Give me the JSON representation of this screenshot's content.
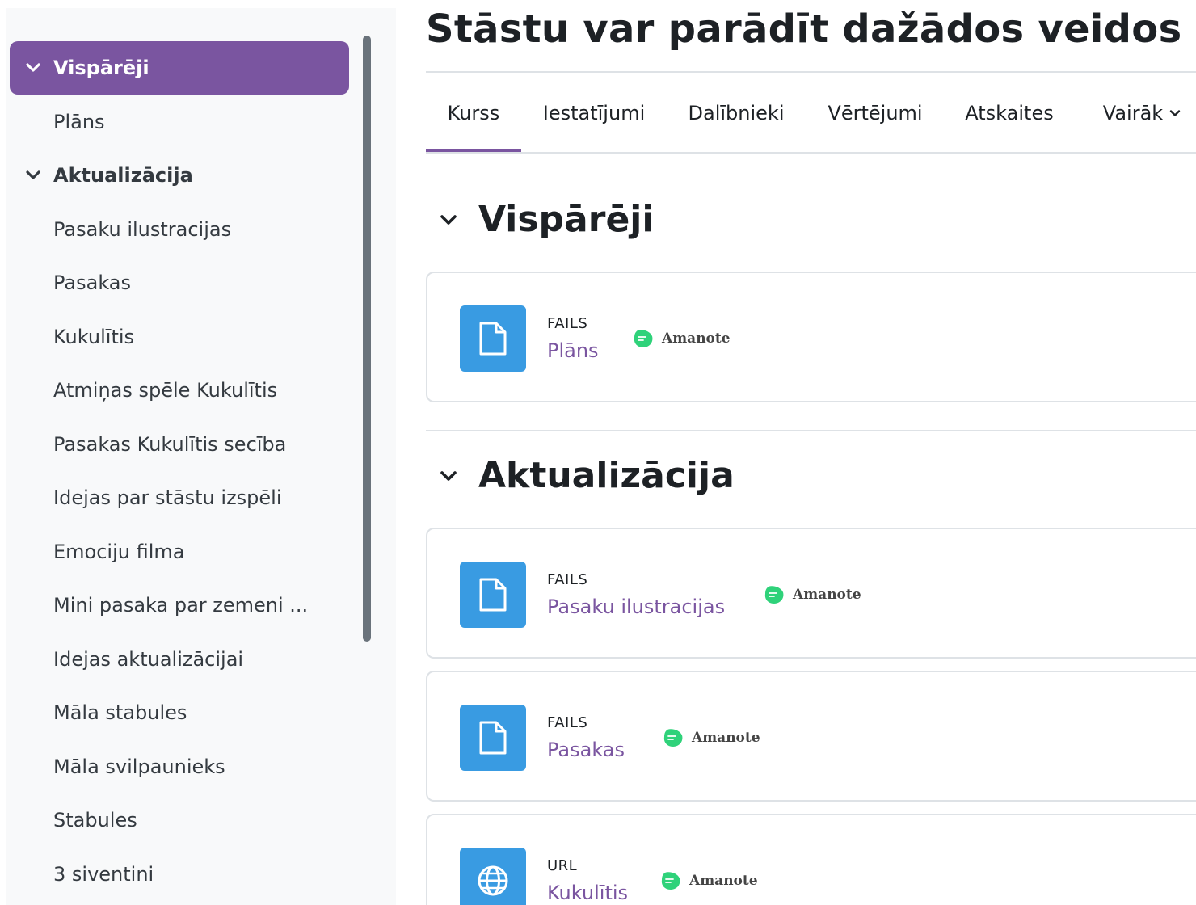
{
  "page_title": "Stāstu var parādīt dažādos veidos",
  "sidebar": {
    "items": [
      {
        "label": "Vispārēji",
        "kind": "section",
        "active": true
      },
      {
        "label": "Plāns",
        "kind": "item"
      },
      {
        "label": "Aktualizācija",
        "kind": "section"
      },
      {
        "label": "Pasaku ilustracijas",
        "kind": "item"
      },
      {
        "label": "Pasakas",
        "kind": "item"
      },
      {
        "label": "Kukulītis",
        "kind": "item"
      },
      {
        "label": "Atmiņas spēle Kukulītis",
        "kind": "item"
      },
      {
        "label": "Pasakas Kukulītis secība",
        "kind": "item"
      },
      {
        "label": "Idejas par stāstu izspēli",
        "kind": "item"
      },
      {
        "label": "Emociju filma",
        "kind": "item"
      },
      {
        "label": "Mini pasaka par zemeni ...",
        "kind": "item"
      },
      {
        "label": "Idejas aktualizācijai",
        "kind": "item"
      },
      {
        "label": "Māla stabules",
        "kind": "item"
      },
      {
        "label": "Māla svilpaunieks",
        "kind": "item"
      },
      {
        "label": "Stabules",
        "kind": "item"
      },
      {
        "label": "3 siventini",
        "kind": "item"
      }
    ]
  },
  "tabs": [
    {
      "label": "Kurss",
      "active": true
    },
    {
      "label": "Iestatījumi"
    },
    {
      "label": "Dalībnieki"
    },
    {
      "label": "Vērtējumi"
    },
    {
      "label": "Atskaites"
    },
    {
      "label": "Vairāk"
    }
  ],
  "sections": [
    {
      "title": "Vispārēji",
      "activities": [
        {
          "type": "FAILS",
          "name": "Plāns",
          "icon": "file-icon",
          "badge": "Amanote"
        }
      ]
    },
    {
      "title": "Aktualizācija",
      "activities": [
        {
          "type": "FAILS",
          "name": "Pasaku ilustracijas",
          "icon": "file-icon",
          "badge": "Amanote"
        },
        {
          "type": "FAILS",
          "name": "Pasakas",
          "icon": "file-icon",
          "badge": "Amanote"
        },
        {
          "type": "URL",
          "name": "Kukulītis",
          "icon": "globe-icon",
          "badge": "Amanote"
        }
      ]
    }
  ],
  "colors": {
    "accent": "#7a55a0",
    "activity_icon_bg": "#399be2",
    "amanote_green": "#2fd27a",
    "sidebar_bg": "#f8f9fa"
  }
}
